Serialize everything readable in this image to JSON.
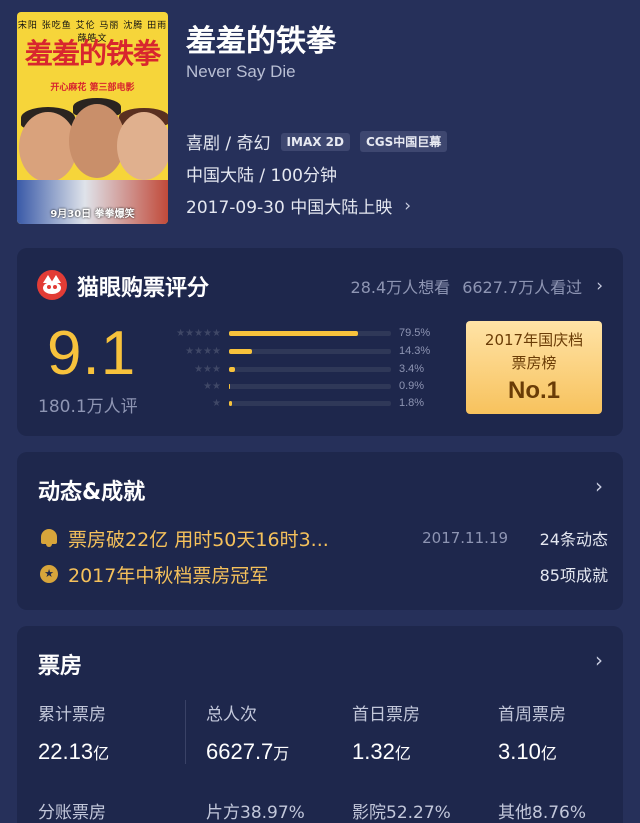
{
  "movie": {
    "title": "羞羞的铁拳",
    "title_en": "Never Say Die",
    "genre": "喜剧 / 奇幻",
    "tags": [
      "IMAX 2D",
      "CGS中国巨幕"
    ],
    "region_duration": "中国大陆 / 100分钟",
    "release": "2017-09-30 中国大陆上映"
  },
  "poster": {
    "credits": "宋阳 张吃鱼  艾伦 马丽 沈腾 田雨 薛皓文",
    "title": "羞羞的铁拳",
    "subtitle": "开心麻花 第三部电影",
    "release": "9月30日 拳拳爆笑"
  },
  "rating": {
    "title": "猫眼购票评分",
    "want": "28.4万人想看",
    "watched": "6627.7万人看过",
    "score": "9.1",
    "count": "180.1万人评",
    "distribution": [
      {
        "stars": 5,
        "percent": 79.5,
        "label": "79.5%"
      },
      {
        "stars": 4,
        "percent": 14.3,
        "label": "14.3%"
      },
      {
        "stars": 3,
        "percent": 3.4,
        "label": "3.4%"
      },
      {
        "stars": 2,
        "percent": 0.9,
        "label": "0.9%"
      },
      {
        "stars": 1,
        "percent": 1.8,
        "label": "1.8%"
      }
    ],
    "badge": {
      "line1": "2017年国庆档",
      "line2": "票房榜",
      "line3": "No.1"
    }
  },
  "dynamics": {
    "title": "动态&成就",
    "item1": {
      "text": "票房破22亿 用时50天16时3...",
      "date": "2017.11.19",
      "right": "24条动态"
    },
    "item2": {
      "text": "2017年中秋档票房冠军",
      "right": "85项成就"
    }
  },
  "boxoffice": {
    "title": "票房",
    "stats": [
      {
        "label": "累计票房",
        "value": "22.13",
        "unit": "亿"
      },
      {
        "label": "总人次",
        "value": "6627.7",
        "unit": "万"
      },
      {
        "label": "首日票房",
        "value": "1.32",
        "unit": "亿"
      },
      {
        "label": "首周票房",
        "value": "3.10",
        "unit": "亿"
      }
    ],
    "split": {
      "label": "分账票房",
      "producer": "片方38.97%",
      "cinema": "影院52.27%",
      "other": "其他8.76%"
    }
  },
  "colors": {
    "accent": "#f7c23c",
    "background": "#26305a",
    "card": "#1e274c",
    "highlight_text": "#f5c15b"
  }
}
